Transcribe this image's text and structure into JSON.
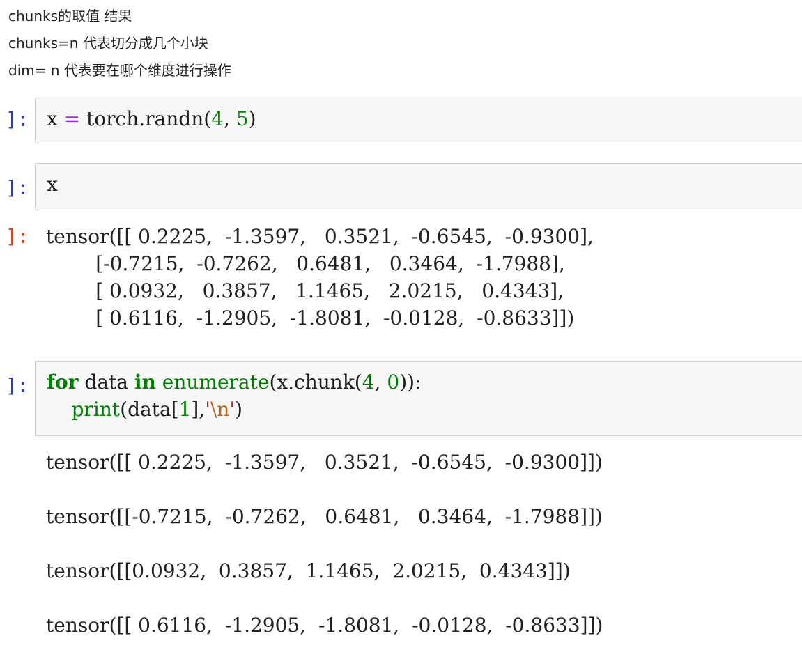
{
  "notes": [
    "chunks的取值 结果",
    "chunks=n 代表切分成几个小块",
    "dim= n 代表要在哪个维度进行操作"
  ],
  "prompts": {
    "input": "]:",
    "output": "]:"
  },
  "cells": [
    {
      "id": "cell-1",
      "code_tokens": [
        {
          "text": "x",
          "cls": "tok-name"
        },
        {
          "text": " = ",
          "cls": "tok-op"
        },
        {
          "text": "torch.randn",
          "cls": "tok-name"
        },
        {
          "text": "(",
          "cls": "tok-name"
        },
        {
          "text": "4",
          "cls": "tok-num"
        },
        {
          "text": ", ",
          "cls": "tok-name"
        },
        {
          "text": "5",
          "cls": "tok-num"
        },
        {
          "text": ")",
          "cls": "tok-name"
        }
      ]
    },
    {
      "id": "cell-2",
      "code_tokens": [
        {
          "text": "x",
          "cls": "tok-name"
        }
      ],
      "output_lines": [
        "tensor([[ 0.2225,  -1.3597,   0.3521,  -0.6545,  -0.9300],",
        "        [-0.7215,  -0.7262,   0.6481,   0.3464,  -1.7988],",
        "        [ 0.0932,   0.3857,   1.1465,   2.0215,   0.4343],",
        "        [ 0.6116,  -1.2905,  -1.8081,  -0.0128,  -0.8633]])"
      ]
    },
    {
      "id": "cell-3",
      "code_tokens_line1": [
        {
          "text": "for",
          "cls": "tok-kw"
        },
        {
          "text": " data ",
          "cls": "tok-name"
        },
        {
          "text": "in",
          "cls": "tok-kw"
        },
        {
          "text": " ",
          "cls": "tok-name"
        },
        {
          "text": "enumerate",
          "cls": "tok-builtin"
        },
        {
          "text": "(x.chunk(",
          "cls": "tok-name"
        },
        {
          "text": "4",
          "cls": "tok-num"
        },
        {
          "text": ", ",
          "cls": "tok-name"
        },
        {
          "text": "0",
          "cls": "tok-num"
        },
        {
          "text": ")):",
          "cls": "tok-name"
        }
      ],
      "code_tokens_line2": [
        {
          "text": "    ",
          "cls": "tok-name"
        },
        {
          "text": "print",
          "cls": "tok-builtin"
        },
        {
          "text": "(data[",
          "cls": "tok-name"
        },
        {
          "text": "1",
          "cls": "tok-num"
        },
        {
          "text": "],",
          "cls": "tok-name"
        },
        {
          "text": "'",
          "cls": "tok-str"
        },
        {
          "text": "\\n",
          "cls": "tok-esc"
        },
        {
          "text": "'",
          "cls": "tok-str"
        },
        {
          "text": ")",
          "cls": "tok-name"
        }
      ],
      "output_blocks": [
        "tensor([[ 0.2225,  -1.3597,   0.3521,  -0.6545,  -0.9300]])",
        "tensor([[-0.7215,  -0.7262,   0.6481,   0.3464,  -1.7988]])",
        "tensor([[0.0932,  0.3857,  1.1465,  2.0215,  0.4343]])",
        "tensor([[ 0.6116,  -1.2905,  -1.8081,  -0.0128,  -0.8633]])"
      ]
    }
  ]
}
